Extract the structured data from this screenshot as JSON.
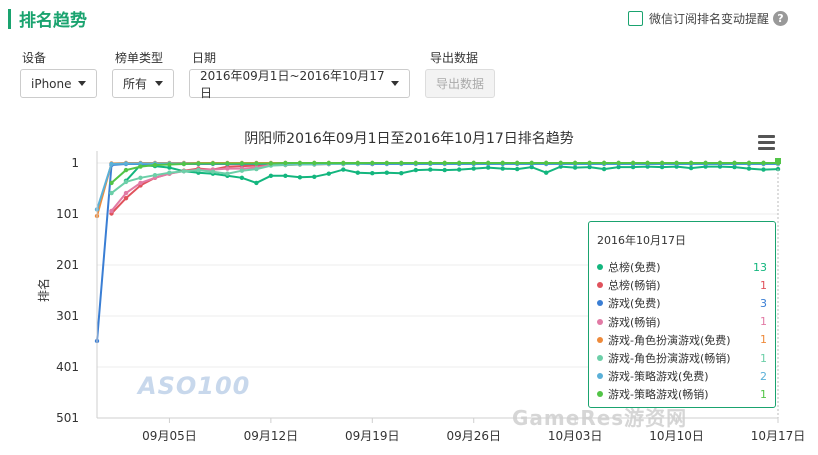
{
  "header": {
    "title": "排名趋势",
    "subscribe_label": "微信订阅排名变动提醒",
    "help_glyph": "?"
  },
  "filters": {
    "device": {
      "label": "设备",
      "value": "iPhone"
    },
    "list_type": {
      "label": "榜单类型",
      "value": "所有"
    },
    "date": {
      "label": "日期",
      "value": "2016年09月1日~2016年10月17日"
    },
    "export": {
      "label": "导出数据",
      "button": "导出数据"
    }
  },
  "chart_data": {
    "type": "line",
    "title": "阴阳师2016年09月1日至2016年10月17日排名趋势",
    "ylabel": "排名",
    "y_inverted": true,
    "ylim": [
      1,
      501
    ],
    "y_ticks": [
      "1",
      "101",
      "201",
      "301",
      "401",
      "501"
    ],
    "x_ticks": [
      "09月05日",
      "09月12日",
      "09月19日",
      "09月26日",
      "10月03日",
      "10月10日",
      "10月17日"
    ],
    "x_start": "2016-08-31",
    "series": [
      {
        "name": "总榜(免费)",
        "color": "#13b67e",
        "start": "2016-09-02",
        "values": [
          36,
          5,
          7,
          10,
          17,
          20,
          22,
          26,
          30,
          40,
          26,
          26,
          29,
          28,
          22,
          14,
          20,
          21,
          20,
          21,
          15,
          14,
          15,
          14,
          12,
          10,
          12,
          13,
          9,
          20,
          8,
          10,
          9,
          13,
          9,
          9,
          8,
          9,
          8,
          11,
          8,
          8,
          9,
          12,
          14,
          13
        ]
      },
      {
        "name": "总榜(畅销)",
        "color": "#e0525c",
        "start": "2016-09-01",
        "values": [
          100,
          70,
          45,
          30,
          22,
          16,
          12,
          14,
          8,
          7,
          6,
          5,
          5,
          4,
          4,
          3,
          3,
          3,
          3,
          2,
          2,
          2,
          2,
          2,
          2,
          2,
          2,
          2,
          2,
          2,
          2,
          2,
          2,
          2,
          2,
          2,
          2,
          2,
          2,
          2,
          2,
          2,
          2,
          2,
          2,
          2,
          1
        ]
      },
      {
        "name": "游戏(免费)",
        "color": "#3a7ed4",
        "start": "2016-08-31",
        "values": [
          350,
          5,
          3,
          3,
          3,
          3,
          3,
          3,
          3,
          3,
          3,
          3,
          3,
          3,
          3,
          3,
          3,
          3,
          3,
          3,
          3,
          3,
          3,
          3,
          3,
          3,
          3,
          3,
          3,
          3,
          3,
          3,
          3,
          3,
          3,
          3,
          3,
          3,
          3,
          3,
          3,
          3,
          3,
          3,
          3,
          3,
          3,
          3
        ]
      },
      {
        "name": "游戏(畅销)",
        "color": "#e27aa5",
        "start": "2016-09-01",
        "values": [
          95,
          60,
          40,
          30,
          22,
          17,
          14,
          14,
          12,
          12,
          10,
          5,
          4,
          4,
          3,
          3,
          3,
          2,
          2,
          2,
          2,
          2,
          2,
          1,
          1,
          1,
          1,
          1,
          1,
          1,
          1,
          1,
          1,
          1,
          1,
          1,
          1,
          1,
          1,
          1,
          1,
          1,
          1,
          1,
          1,
          1,
          1
        ]
      },
      {
        "name": "游戏-角色扮演游戏(免费)",
        "color": "#ee8a3a",
        "start": "2016-08-31",
        "values": [
          105,
          2,
          1,
          1,
          1,
          1,
          1,
          1,
          1,
          1,
          1,
          1,
          1,
          1,
          1,
          1,
          1,
          1,
          1,
          1,
          1,
          1,
          1,
          1,
          1,
          1,
          1,
          1,
          1,
          1,
          1,
          1,
          1,
          1,
          1,
          1,
          1,
          1,
          1,
          1,
          1,
          1,
          1,
          1,
          1,
          1,
          1,
          1
        ]
      },
      {
        "name": "游戏-角色扮演游戏(畅销)",
        "color": "#6ccfa8",
        "start": "2016-09-01",
        "values": [
          60,
          38,
          30,
          25,
          20,
          17,
          15,
          18,
          22,
          16,
          13,
          6,
          5,
          4,
          4,
          3,
          3,
          3,
          2,
          2,
          2,
          2,
          2,
          2,
          1,
          1,
          1,
          1,
          1,
          1,
          1,
          1,
          1,
          1,
          1,
          1,
          1,
          1,
          1,
          1,
          1,
          1,
          1,
          1,
          1,
          1,
          1
        ]
      },
      {
        "name": "游戏-策略游戏(免费)",
        "color": "#5ab0d8",
        "start": "2016-08-31",
        "values": [
          92,
          3,
          2,
          2,
          2,
          2,
          2,
          2,
          2,
          2,
          2,
          2,
          2,
          2,
          2,
          2,
          2,
          2,
          2,
          2,
          2,
          2,
          2,
          2,
          2,
          2,
          2,
          2,
          2,
          2,
          2,
          2,
          2,
          2,
          2,
          2,
          2,
          2,
          2,
          2,
          2,
          2,
          2,
          2,
          2,
          2,
          2,
          2
        ]
      },
      {
        "name": "游戏-策略游戏(畅销)",
        "color": "#52c447",
        "start": "2016-09-01",
        "values": [
          40,
          15,
          8,
          5,
          4,
          3,
          2,
          2,
          2,
          2,
          2,
          2,
          1,
          1,
          1,
          1,
          1,
          1,
          1,
          1,
          1,
          1,
          1,
          1,
          1,
          1,
          1,
          1,
          1,
          1,
          1,
          1,
          1,
          1,
          1,
          1,
          1,
          1,
          1,
          1,
          1,
          1,
          1,
          1,
          1,
          1,
          1
        ]
      }
    ]
  },
  "tooltip": {
    "date": "2016年10月17日",
    "rows": [
      {
        "name": "总榜(免费)",
        "value": "13",
        "color": "#13b67e"
      },
      {
        "name": "总榜(畅销)",
        "value": "1",
        "color": "#e0525c"
      },
      {
        "name": "游戏(免费)",
        "value": "3",
        "color": "#3a7ed4"
      },
      {
        "name": "游戏(畅销)",
        "value": "1",
        "color": "#e27aa5"
      },
      {
        "name": "游戏-角色扮演游戏(免费)",
        "value": "1",
        "color": "#ee8a3a"
      },
      {
        "name": "游戏-角色扮演游戏(畅销)",
        "value": "1",
        "color": "#6ccfa8"
      },
      {
        "name": "游戏-策略游戏(免费)",
        "value": "2",
        "color": "#5ab0d8"
      },
      {
        "name": "游戏-策略游戏(畅销)",
        "value": "1",
        "color": "#52c447"
      }
    ]
  },
  "watermarks": {
    "aso": "ASO100",
    "site": "GameRes游资网"
  }
}
